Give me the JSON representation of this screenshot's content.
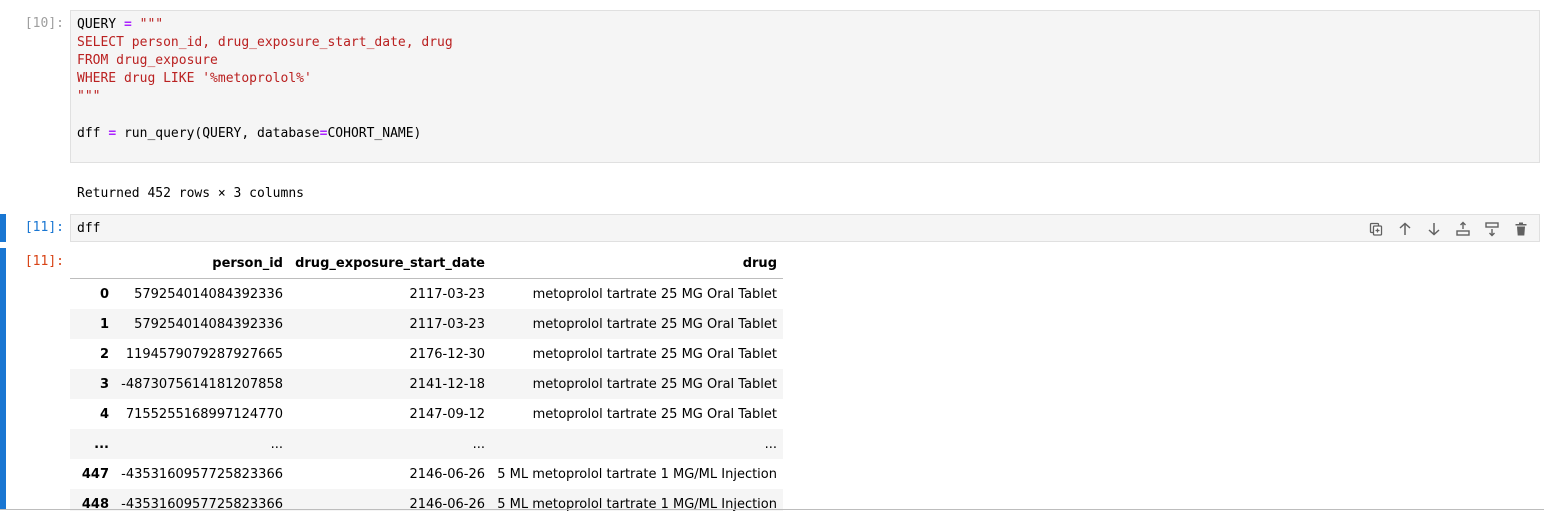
{
  "cell10": {
    "prompt": "[10]:",
    "code": {
      "line1_var": "QUERY",
      "line1_op": "=",
      "line1_str": "\"\"\"",
      "line2": "SELECT person_id, drug_exposure_start_date, drug",
      "line3": "FROM drug_exposure",
      "line4": "WHERE drug LIKE '%metoprolol%'",
      "line5": "\"\"\"",
      "line7_a": "dff",
      "line7_op": "=",
      "line7_b": "run_query(QUERY, database",
      "line7_op2": "=",
      "line7_c": "COHORT_NAME)"
    },
    "output": "Returned 452 rows × 3 columns"
  },
  "cell11": {
    "prompt": "[11]:",
    "code": "dff",
    "out_prompt": "[11]:",
    "toolbar": [
      {
        "name": "duplicate-cell-icon"
      },
      {
        "name": "move-up-icon"
      },
      {
        "name": "move-down-icon"
      },
      {
        "name": "insert-above-icon"
      },
      {
        "name": "insert-below-icon"
      },
      {
        "name": "delete-cell-icon"
      }
    ]
  },
  "table": {
    "columns": [
      "",
      "person_id",
      "drug_exposure_start_date",
      "drug"
    ],
    "rows": [
      {
        "idx": "0",
        "person_id": "579254014084392336",
        "date": "2117-03-23",
        "drug": "metoprolol tartrate 25 MG Oral Tablet"
      },
      {
        "idx": "1",
        "person_id": "579254014084392336",
        "date": "2117-03-23",
        "drug": "metoprolol tartrate 25 MG Oral Tablet"
      },
      {
        "idx": "2",
        "person_id": "1194579079287927665",
        "date": "2176-12-30",
        "drug": "metoprolol tartrate 25 MG Oral Tablet"
      },
      {
        "idx": "3",
        "person_id": "-4873075614181207858",
        "date": "2141-12-18",
        "drug": "metoprolol tartrate 25 MG Oral Tablet"
      },
      {
        "idx": "4",
        "person_id": "7155255168997124770",
        "date": "2147-09-12",
        "drug": "metoprolol tartrate 25 MG Oral Tablet"
      },
      {
        "idx": "...",
        "person_id": "...",
        "date": "...",
        "drug": "..."
      },
      {
        "idx": "447",
        "person_id": "-4353160957725823366",
        "date": "2146-06-26",
        "drug": "5 ML metoprolol tartrate 1 MG/ML Injection"
      },
      {
        "idx": "448",
        "person_id": "-4353160957725823366",
        "date": "2146-06-26",
        "drug": "5 ML metoprolol tartrate 1 MG/ML Injection"
      }
    ]
  },
  "colors": {
    "accent": "#1976d2",
    "out_prompt": "#d84315",
    "string": "#ba2121",
    "operator": "#aa22ff"
  }
}
